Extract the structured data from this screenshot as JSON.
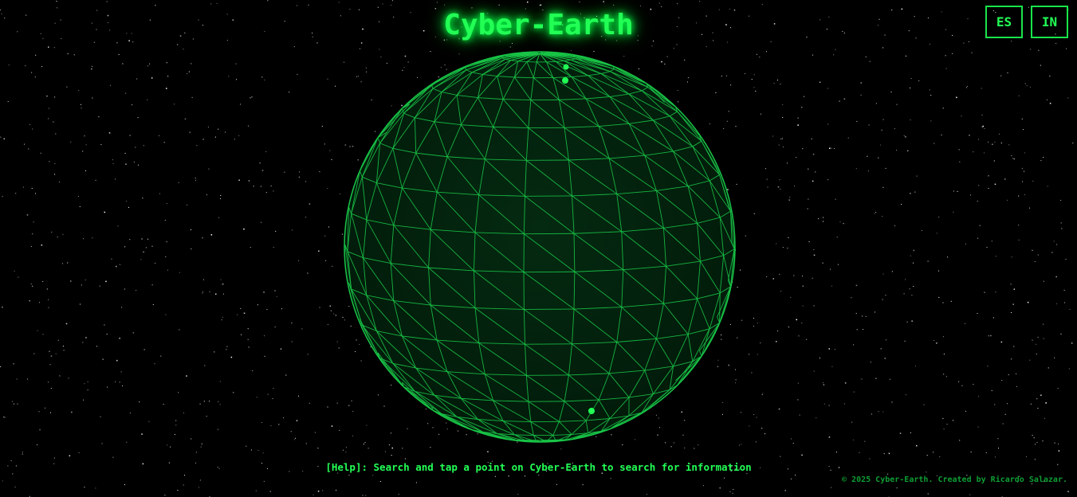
{
  "header": {
    "title": "Cyber-Earth"
  },
  "language_buttons": [
    {
      "label": "ES"
    },
    {
      "label": "IN"
    }
  ],
  "help": {
    "text": "[Help]: Search and tap a point on Cyber-Earth to search for information"
  },
  "footer": {
    "text": "© 2025 Cyber-Earth. Created by Ricardo Salazar."
  },
  "colors": {
    "background": "#000000",
    "accent": "#22ff55",
    "globe_fill": "#03250f",
    "wireframe": "#19c447",
    "footer_text": "#0d9e33"
  },
  "globe": {
    "markers": [
      "location-marker",
      "location-marker",
      "location-marker"
    ]
  }
}
